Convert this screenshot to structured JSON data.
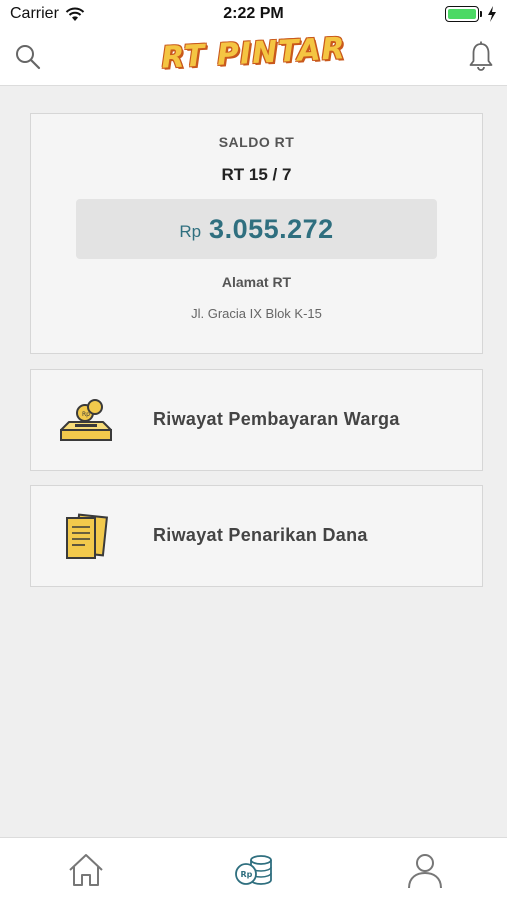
{
  "status_bar": {
    "carrier": "Carrier",
    "time": "2:22 PM"
  },
  "header": {
    "logo_text": "RT PINTAR",
    "search_icon": "search-icon",
    "bell_icon": "bell-icon"
  },
  "balance": {
    "label": "SALDO RT",
    "rt_number": "RT 15 / 7",
    "currency": "Rp",
    "amount": "3.055.272",
    "address_label": "Alamat RT",
    "address": "Jl. Gracia IX Blok K-15"
  },
  "menu": [
    {
      "label": "Riwayat Pembayaran Warga",
      "icon": "coin-box-icon"
    },
    {
      "label": "Riwayat Penarikan Dana",
      "icon": "document-icon"
    }
  ],
  "tabs": [
    {
      "name": "home",
      "icon": "home-icon"
    },
    {
      "name": "finance",
      "icon": "coins-icon",
      "active": true
    },
    {
      "name": "profile",
      "icon": "user-icon"
    }
  ],
  "colors": {
    "accent": "#2f6f7f",
    "logo": "#f4c542",
    "icon_yellow": "#f2c94c",
    "background": "#efefef"
  }
}
